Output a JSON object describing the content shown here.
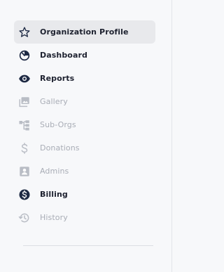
{
  "sidebar": {
    "items": [
      {
        "label": "Organization Profile",
        "icon": "star-icon",
        "state": "active"
      },
      {
        "label": "Dashboard",
        "icon": "dashboard-icon",
        "state": "enabled"
      },
      {
        "label": "Reports",
        "icon": "eye-icon",
        "state": "enabled"
      },
      {
        "label": "Gallery",
        "icon": "gallery-icon",
        "state": "disabled"
      },
      {
        "label": "Sub-Orgs",
        "icon": "org-tree-icon",
        "state": "disabled"
      },
      {
        "label": "Donations",
        "icon": "dollar-icon",
        "state": "disabled"
      },
      {
        "label": "Admins",
        "icon": "admin-badge-icon",
        "state": "disabled"
      },
      {
        "label": "Billing",
        "icon": "billing-dollar-circle-icon",
        "state": "enabled"
      },
      {
        "label": "History",
        "icon": "history-icon",
        "state": "disabled"
      }
    ]
  },
  "colors": {
    "active_bg": "#e8e9ec",
    "text_enabled": "#1e2230",
    "text_disabled": "#a9adb6",
    "icon_enabled": "#1e2a44",
    "icon_disabled": "#b9bdc5"
  }
}
